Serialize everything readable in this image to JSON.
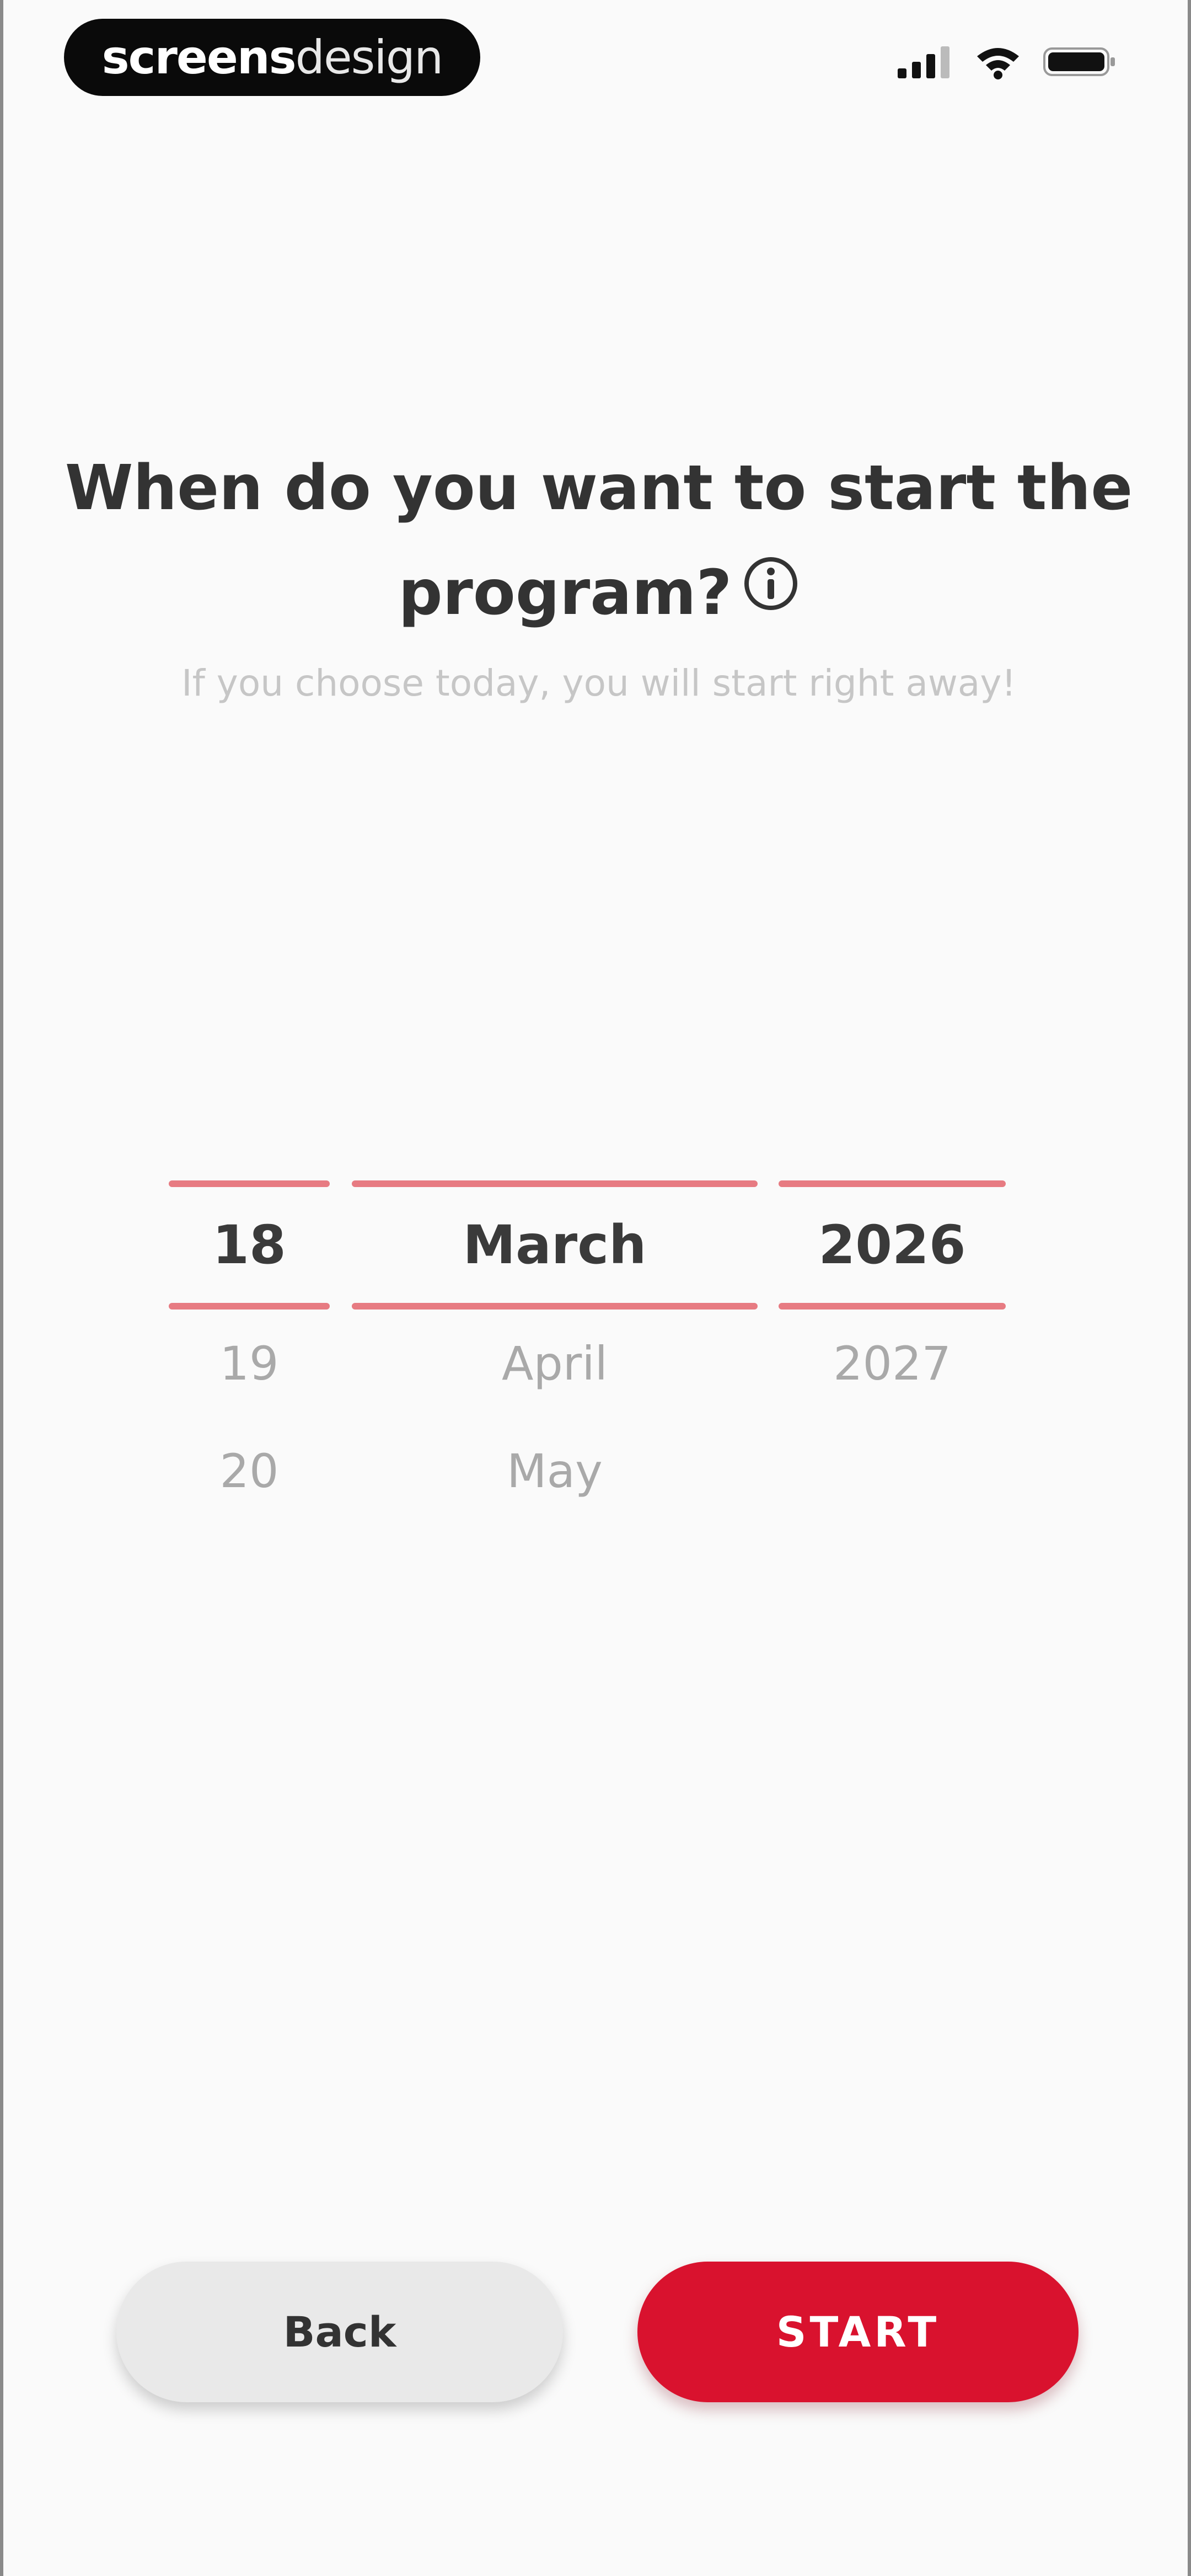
{
  "status_bar": {
    "brand_bold": "screens",
    "brand_light": "design",
    "icons": [
      "cellular-signal-icon",
      "wifi-icon",
      "battery-icon"
    ]
  },
  "heading": {
    "title_line1": "When do you want to start the",
    "title_line2": "program?",
    "subtitle": "If you choose today, you will start right away!"
  },
  "date_picker": {
    "day": {
      "selected": "18",
      "options": [
        "19",
        "20"
      ]
    },
    "month": {
      "selected": "March",
      "options": [
        "April",
        "May"
      ]
    },
    "year": {
      "selected": "2026",
      "options": [
        "2027"
      ]
    }
  },
  "actions": {
    "back_label": "Back",
    "start_label": "START"
  },
  "colors": {
    "accent": "#d9122e",
    "picker_rule": "#e77b82",
    "background": "#fafafa"
  }
}
